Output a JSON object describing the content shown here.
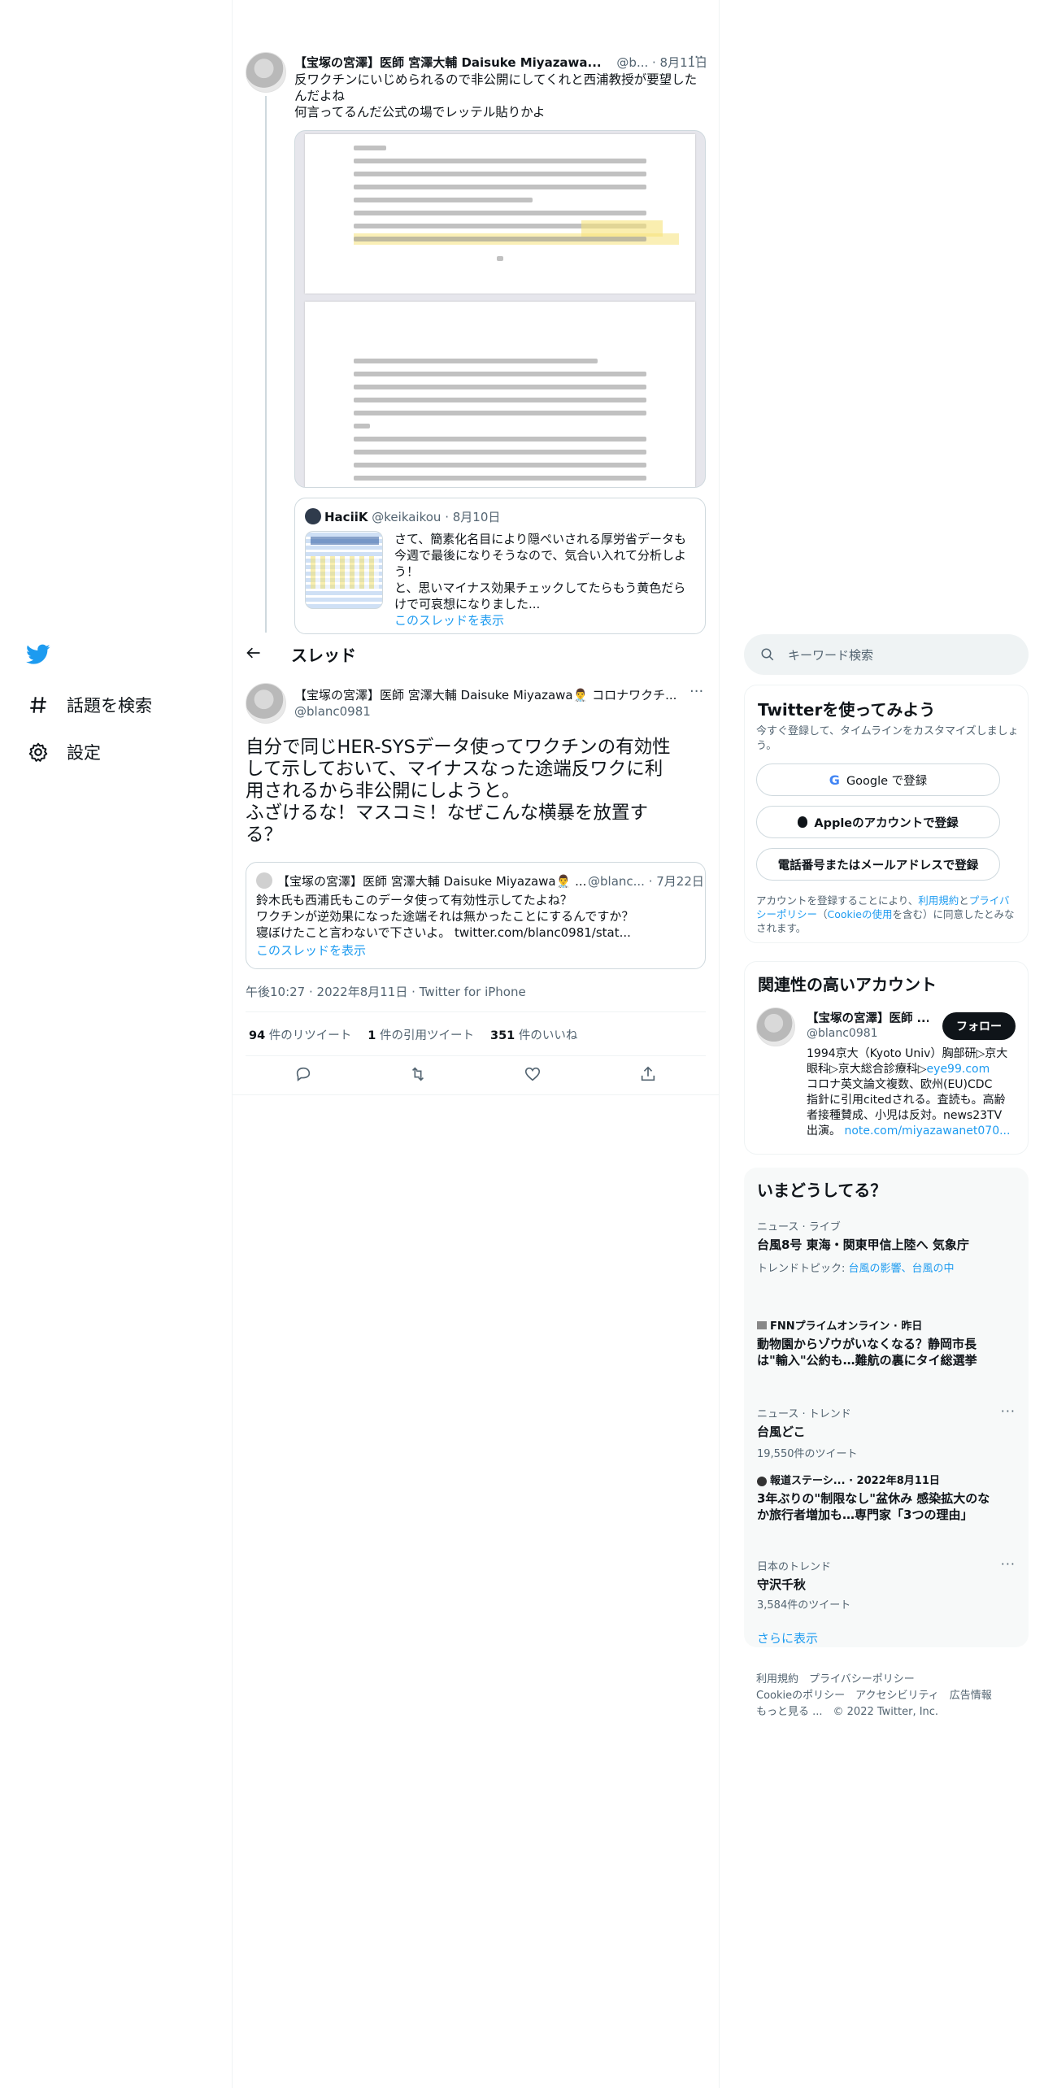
{
  "nav": {
    "explore": "話題を検索",
    "settings": "設定"
  },
  "thread_header": "スレッド",
  "prev_tweet": {
    "name": "【宝塚の宮澤】医師 宮澤大輔 Daisuke Miyazawa...",
    "handle_date": "@b... · 8月11日",
    "text_lines": [
      "反ワクチンにいじめられるので非公開にしてくれと西浦教授が要望したんだよね",
      "何言ってるんだ公式の場でレッテル貼りかよ"
    ],
    "quote": {
      "name": "HaciiK",
      "handle": "@keikaikou",
      "date": "· 8月10日",
      "text_lines": [
        "さて、簡素化名目により隠ぺいされる厚労省データも",
        "今週で最後になりそうなので、気合い入れて分析しよ",
        "う！",
        "と、思いマイナス効果チェックしてたらもう黄色だら",
        "けで可哀想になりました..."
      ],
      "show_thread": "このスレッドを表示"
    }
  },
  "main_tweet": {
    "name": "【宝塚の宮澤】医師 宮澤大輔 Daisuke Miyazawa👨‍⚕️ コロナワクチ...",
    "handle": "@blanc0981",
    "text_lines": [
      "自分で同じHER-SYSデータ使ってワクチンの有効性",
      "して示しておいて、マイナスなった途端反ワクに利",
      "用されるから非公開にしようと。",
      "ふざけるな！マスコミ！なぜこんな横暴を放置す",
      "る？"
    ],
    "quote": {
      "name": "【宝塚の宮澤】医師 宮澤大輔 Daisuke Miyazawa👨‍⚕️ ...",
      "handle_date": "@blanc... · 7月22日",
      "text_lines": [
        "鈴木氏も西浦氏もこのデータ使って有効性示してたよね？",
        "ワクチンが逆効果になった途端それは無かったことにするんですか？",
        "寝ぼけたこと言わないで下さいよ。 twitter.com/blanc0981/stat..."
      ],
      "show_thread": "このスレッドを表示"
    },
    "timestamp": "午後10:27 · 2022年8月11日 · Twitter for iPhone",
    "stats": {
      "retweets_num": "94",
      "retweets_label": "件のリツイート",
      "quotes_num": "1",
      "quotes_label": "件の引用ツイート",
      "likes_num": "351",
      "likes_label": "件のいいね"
    }
  },
  "search": {
    "placeholder": "キーワード検索"
  },
  "signup": {
    "title": "Twitterを使ってみよう",
    "subtitle_lines": [
      "今すぐ登録して、タイムラインをカスタマイズしましょ",
      "う。"
    ],
    "google": "Google で登録",
    "apple": "Appleのアカウントで登録",
    "phone": "電話番号またはメールアドレスで登録",
    "legal_a": "アカウントを登録することにより、",
    "legal_terms": "利用規約",
    "legal_b": "と",
    "legal_privacy": "プライバシーポリシー",
    "legal_c": "（",
    "legal_cookie": "Cookieの使用",
    "legal_d": "を含む）に同意したとみなされます。"
  },
  "related": {
    "title": "関連性の高いアカウント",
    "name": "【宝塚の宮澤】医師 ...",
    "handle": "@blanc0981",
    "follow": "フォロー",
    "bio_lines": [
      "1994京大（Kyoto Univ）胸部研▷京大",
      "眼科▷京大総合診療科▷",
      "コロナ英文論文複数、欧州(EU)CDC",
      "指針に引用citedされる。査読も。高齢",
      "者接種賛成、小児は反対。news23TV",
      "出演。 "
    ],
    "bio_link1": "eye99.com",
    "bio_link2": "note.com/miyazawanet070..."
  },
  "trends": {
    "title": "いまどうしてる？",
    "items": [
      {
        "meta": "ニュース · ライブ",
        "title": "台風8号 東海・関東甲信上陸へ 気象庁",
        "topic_label": "トレンドトピック: ",
        "topic_links": "台風の影響、台風の中"
      },
      {
        "meta": "FNNプライムオンライン · 昨日",
        "title": "動物園からゾウがいなくなる？静岡市長は\"輸入\"公約も…難航の裏にタイ総選挙"
      },
      {
        "meta": "ニュース · トレンド",
        "title": "台風どこ",
        "count": "19,550件のツイート"
      },
      {
        "meta": "報道ステーシ... · 2022年8月11日",
        "title": "3年ぶりの\"制限なし\"盆休み 感染拡大のなか旅行者増加も…専門家「3つの理由」"
      },
      {
        "meta": "日本のトレンド",
        "title": "守沢千秋",
        "count": "3,584件のツイート"
      }
    ],
    "show_more": "さらに表示"
  },
  "footer": {
    "line1": "利用規約　プライバシーポリシー",
    "line2": "Cookieのポリシー　アクセシビリティ　広告情報",
    "line3": "もっと見る ...　© 2022 Twitter, Inc."
  }
}
